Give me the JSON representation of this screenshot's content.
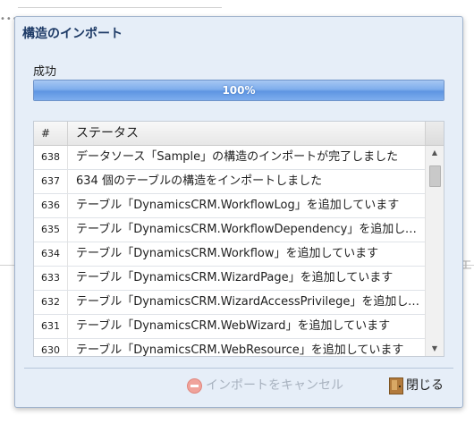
{
  "dialog": {
    "title": "構造のインポート",
    "status_label": "成功",
    "progress": {
      "value_percent": 100,
      "text": "100%"
    },
    "grid": {
      "columns": [
        "#",
        "ステータス"
      ],
      "rows": [
        {
          "num": "638",
          "message": "データソース「Sample」の構造のインポートが完了しました"
        },
        {
          "num": "637",
          "message": "634 個のテーブルの構造をインポートしました"
        },
        {
          "num": "636",
          "message": "テーブル「DynamicsCRM.WorkflowLog」を追加しています"
        },
        {
          "num": "635",
          "message": "テーブル「DynamicsCRM.WorkflowDependency」を追加しています"
        },
        {
          "num": "634",
          "message": "テーブル「DynamicsCRM.Workflow」を追加しています"
        },
        {
          "num": "633",
          "message": "テーブル「DynamicsCRM.WizardPage」を追加しています"
        },
        {
          "num": "632",
          "message": "テーブル「DynamicsCRM.WizardAccessPrivilege」を追加しています"
        },
        {
          "num": "631",
          "message": "テーブル「DynamicsCRM.WebWizard」を追加しています"
        },
        {
          "num": "630",
          "message": "テーブル「DynamicsCRM.WebResource」を追加しています"
        }
      ]
    },
    "buttons": {
      "cancel_label": "インポートをキャンセル",
      "close_label": "閉じる"
    }
  },
  "background": {
    "peek_text": "エ"
  },
  "icons": {
    "scroll_up": "triangle-up-icon",
    "scroll_down": "triangle-down-icon",
    "cancel": "cancel-icon",
    "close": "door-icon"
  },
  "colors": {
    "title": "#1d3a66",
    "dialog_bg": "#e6eef8",
    "progress_fill": "#5e95e2",
    "disabled_text": "#a8b2bf"
  }
}
